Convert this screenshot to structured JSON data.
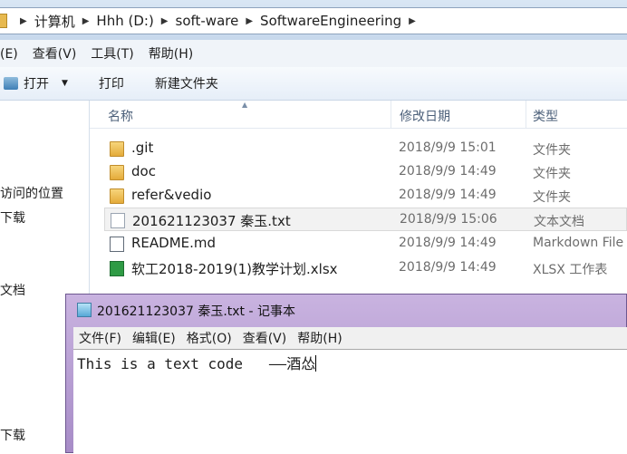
{
  "explorer": {
    "breadcrumb": [
      "计算机",
      "Hhh (D:)",
      "soft-ware",
      "SoftwareEngineering"
    ],
    "menu": [
      "辑(E)",
      "查看(V)",
      "工具(T)",
      "帮助(H)"
    ],
    "toolbar": {
      "open_label": "打开",
      "print_label": "打印",
      "new_folder_label": "新建文件夹"
    },
    "nav_items": [
      "访问的位置",
      "下载",
      "文档",
      "下载"
    ],
    "columns": {
      "name": "名称",
      "date": "修改日期",
      "type": "类型"
    },
    "files": [
      {
        "icon": "folder-icon",
        "name": ".git",
        "date": "2018/9/9 15:01",
        "type": "文件夹"
      },
      {
        "icon": "folder-icon",
        "name": "doc",
        "date": "2018/9/9 14:49",
        "type": "文件夹"
      },
      {
        "icon": "folder-icon",
        "name": "refer&vedio",
        "date": "2018/9/9 14:49",
        "type": "文件夹"
      },
      {
        "icon": "text-file-icon",
        "name": "201621123037 秦玉.txt",
        "date": "2018/9/9 15:06",
        "type": "文本文档"
      },
      {
        "icon": "markdown-file-icon",
        "name": "README.md",
        "date": "2018/9/9 14:49",
        "type": "Markdown File"
      },
      {
        "icon": "excel-file-icon",
        "name": "软工2018-2019(1)教学计划.xlsx",
        "date": "2018/9/9 14:49",
        "type": "XLSX 工作表"
      }
    ]
  },
  "notepad": {
    "title": "201621123037 秦玉.txt - 记事本",
    "menu": [
      "文件(F)",
      "编辑(E)",
      "格式(O)",
      "查看(V)",
      "帮助(H)"
    ],
    "content": "This is a text code   ——酒怂"
  }
}
